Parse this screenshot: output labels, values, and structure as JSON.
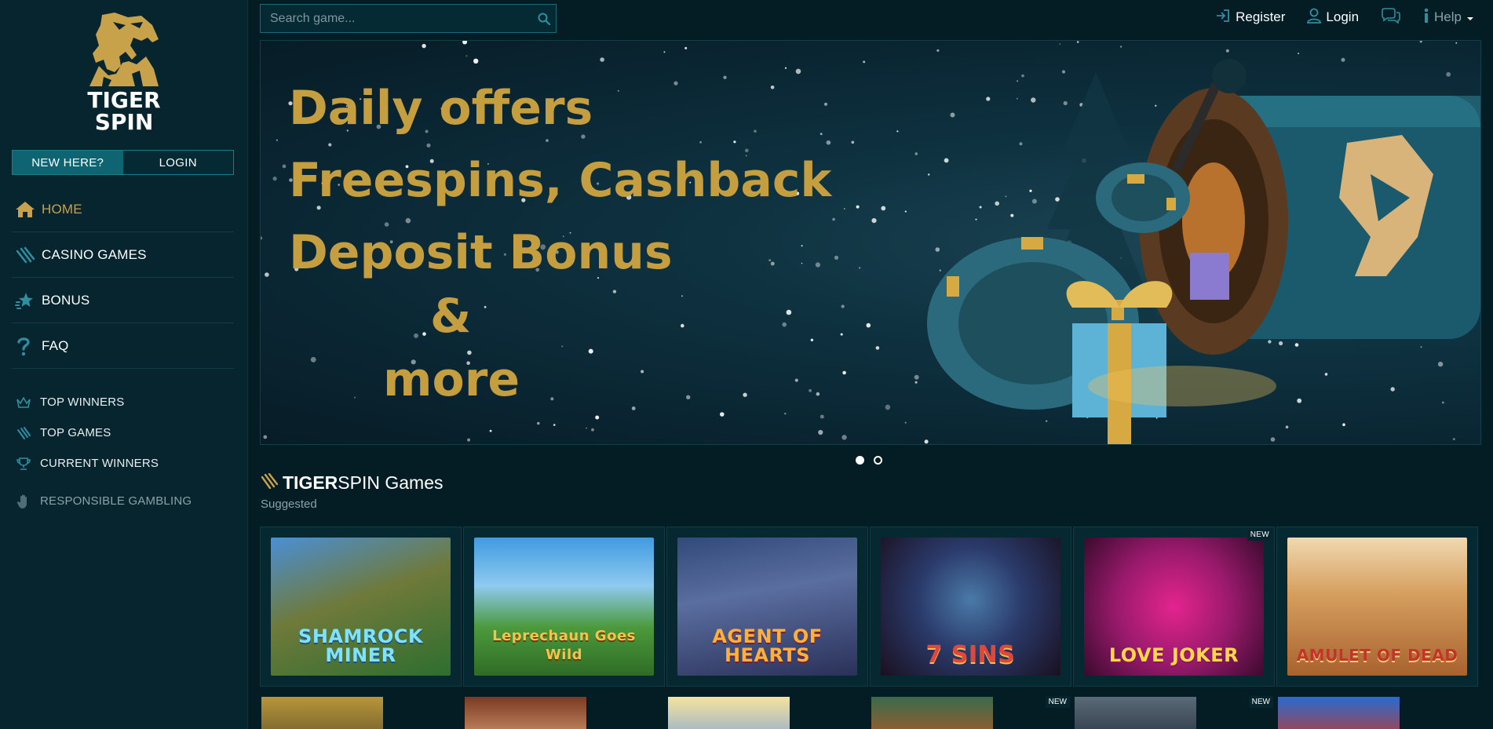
{
  "brand": {
    "line1": "TIGER",
    "line2": "SPIN",
    "gold": "#c8a24a"
  },
  "auth": {
    "new_here": "NEW HERE?",
    "login": "LOGIN"
  },
  "nav": [
    {
      "label": "HOME",
      "icon": "home-icon",
      "active": true
    },
    {
      "label": "CASINO GAMES",
      "icon": "claw-icon"
    },
    {
      "label": "BONUS",
      "icon": "star-icon"
    },
    {
      "label": "FAQ",
      "icon": "question-icon"
    }
  ],
  "subnav": [
    {
      "label": "TOP WINNERS",
      "icon": "crown-icon"
    },
    {
      "label": "TOP GAMES",
      "icon": "claw-icon"
    },
    {
      "label": "CURRENT WINNERS",
      "icon": "trophy-icon"
    },
    {
      "label": "RESPONSIBLE GAMBLING",
      "icon": "hand-icon"
    }
  ],
  "search": {
    "placeholder": "Search game..."
  },
  "topnav": {
    "register": "Register",
    "login": "Login",
    "help": "Help"
  },
  "banner": {
    "lines": [
      "Daily offers",
      "Freespins, Cashback",
      "Deposit Bonus",
      "&",
      "more"
    ]
  },
  "carousel": {
    "count": 2,
    "active": 0
  },
  "games": {
    "title_bold": "TIGER",
    "title_rest": "SPIN Games",
    "subtitle": "Suggested",
    "row1": [
      {
        "name": "SHAMROCK MINER",
        "badge": ""
      },
      {
        "name": "Leprechaun Goes Wild",
        "badge": ""
      },
      {
        "name": "AGENT OF HEARTS",
        "badge": ""
      },
      {
        "name": "7 SINS",
        "badge": ""
      },
      {
        "name": "LOVE JOKER",
        "badge": "NEW"
      },
      {
        "name": "AMULET OF DEAD",
        "badge": ""
      }
    ],
    "row2_badges": [
      "",
      "",
      "",
      "NEW",
      "NEW",
      ""
    ]
  }
}
